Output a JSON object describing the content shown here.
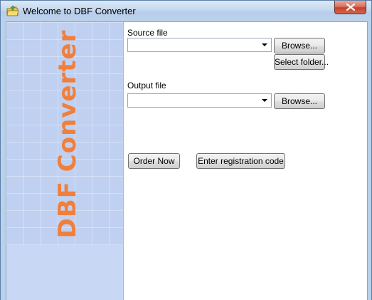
{
  "window": {
    "title": "Welcome to DBF Converter",
    "icon": "folder-app-icon"
  },
  "side_panel": {
    "title": "DBF Converter",
    "title_color": "#f07f3c"
  },
  "source": {
    "label": "Source file",
    "value": "",
    "browse_label": "Browse...",
    "select_folder_label": "Select folder..."
  },
  "output": {
    "label": "Output file",
    "value": "",
    "browse_label": "Browse..."
  },
  "actions": {
    "order_now_label": "Order Now",
    "register_label": "Enter registration code"
  }
}
